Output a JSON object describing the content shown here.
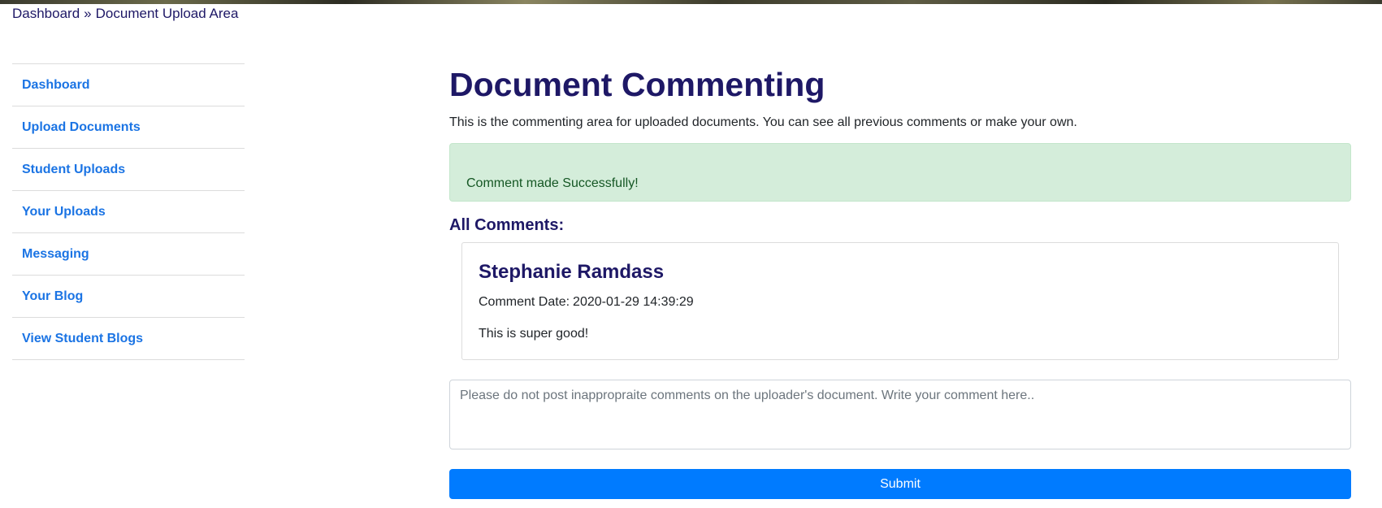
{
  "breadcrumb": {
    "home": "Dashboard",
    "separator": "»",
    "current": "Document Upload Area"
  },
  "sidebar": {
    "items": [
      {
        "label": "Dashboard"
      },
      {
        "label": "Upload Documents"
      },
      {
        "label": "Student Uploads"
      },
      {
        "label": "Your Uploads"
      },
      {
        "label": "Messaging"
      },
      {
        "label": "Your Blog"
      },
      {
        "label": "View Student Blogs"
      }
    ]
  },
  "main": {
    "title": "Document Commenting",
    "intro": "This is the commenting area for uploaded documents. You can see all previous comments or make your own.",
    "alert": "Comment made Successfully!",
    "comments_heading": "All Comments:",
    "comments": [
      {
        "author": "Stephanie Ramdass",
        "date_label": "Comment Date:",
        "date": "2020-01-29 14:39:29",
        "text": "This is super good!"
      }
    ],
    "comment_input": {
      "placeholder": "Please do not post inappropraite comments on the uploader's document. Write your comment here..",
      "value": ""
    },
    "submit_label": "Submit"
  },
  "colors": {
    "heading": "#1e1866",
    "link": "#1b74e4",
    "primary": "#007bff",
    "success_bg": "#d4edda",
    "success_text": "#155724"
  }
}
